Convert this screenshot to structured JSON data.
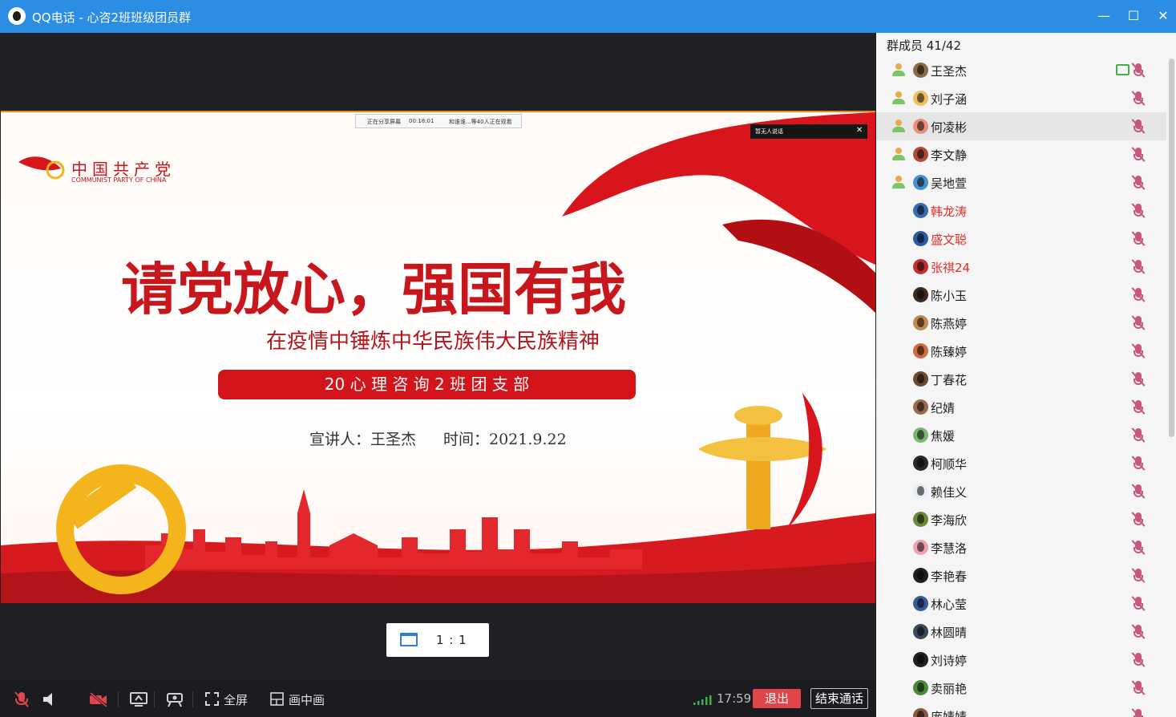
{
  "window": {
    "title": "QQ电话 - 心咨2班班级团员群",
    "minimize_label": "—",
    "maximize_label": "☐",
    "close_label": "✕"
  },
  "slide": {
    "party_logo_cn": "中国共产党",
    "party_logo_en": "COMMUNIST PARTY OF CHINA",
    "headline": "请党放心，强国有我",
    "subtitle": "在疫情中锤炼中华民族伟大民族精神",
    "banner": "20 心 理 咨 询 2 班 团 支 部",
    "speaker": "宣讲人：王圣杰",
    "date": "时间：2021.9.22",
    "top_bar_status": "正在分享屏幕",
    "top_bar_time": "00:18:01",
    "top_bar_note": "和谁谁...等40人正在观看",
    "talk_label": "暂无人说话",
    "talk_close": "✕"
  },
  "stage": {
    "ratio_label": "1 : 1"
  },
  "toolbar": {
    "fullscreen_label": "全屏",
    "pip_label": "画中画",
    "time": "17:59",
    "exit_label": "退出",
    "end_call_label": "结束通话"
  },
  "panel": {
    "header": "群成员 41/42",
    "members": [
      {
        "name": "王圣杰",
        "owner": true,
        "red": false,
        "sharing": true,
        "avatar": "#8a6a4a"
      },
      {
        "name": "刘子涵",
        "owner": true,
        "red": false,
        "sharing": false,
        "avatar": "#f0c060"
      },
      {
        "name": "何凌彬",
        "owner": true,
        "red": false,
        "sharing": false,
        "avatar": "#e8907a"
      },
      {
        "name": "李文静",
        "owner": true,
        "red": false,
        "sharing": false,
        "avatar": "#b04a3a"
      },
      {
        "name": "吴地萱",
        "owner": true,
        "red": false,
        "sharing": false,
        "avatar": "#4a90d0"
      },
      {
        "name": "韩龙涛",
        "owner": false,
        "red": true,
        "sharing": false,
        "avatar": "#3a6ab0"
      },
      {
        "name": "盛文聪",
        "owner": false,
        "red": true,
        "sharing": false,
        "avatar": "#2c5aa0"
      },
      {
        "name": "张祺24",
        "owner": false,
        "red": true,
        "sharing": false,
        "avatar": "#c03030"
      },
      {
        "name": "陈小玉",
        "owner": false,
        "red": false,
        "sharing": false,
        "avatar": "#3a2a20"
      },
      {
        "name": "陈燕婷",
        "owner": false,
        "red": false,
        "sharing": false,
        "avatar": "#c08a50"
      },
      {
        "name": "陈臻婷",
        "owner": false,
        "red": false,
        "sharing": false,
        "avatar": "#d06a40"
      },
      {
        "name": "丁春花",
        "owner": false,
        "red": false,
        "sharing": false,
        "avatar": "#6a4a30"
      },
      {
        "name": "纪婧",
        "owner": false,
        "red": false,
        "sharing": false,
        "avatar": "#9a6a50"
      },
      {
        "name": "焦媛",
        "owner": false,
        "red": false,
        "sharing": false,
        "avatar": "#7ab870"
      },
      {
        "name": "柯顺华",
        "owner": false,
        "red": false,
        "sharing": false,
        "avatar": "#2a2a2a"
      },
      {
        "name": "赖佳义",
        "owner": false,
        "red": false,
        "sharing": false,
        "avatar": "#e8eef5"
      },
      {
        "name": "李海欣",
        "owner": false,
        "red": false,
        "sharing": false,
        "avatar": "#6a8a3a"
      },
      {
        "name": "李慧洛",
        "owner": false,
        "red": false,
        "sharing": false,
        "avatar": "#f0a0b0"
      },
      {
        "name": "李艳春",
        "owner": false,
        "red": false,
        "sharing": false,
        "avatar": "#202020"
      },
      {
        "name": "林心莹",
        "owner": false,
        "red": false,
        "sharing": false,
        "avatar": "#3a5a9a"
      },
      {
        "name": "林圆晴",
        "owner": false,
        "red": false,
        "sharing": false,
        "avatar": "#3a4a5a"
      },
      {
        "name": "刘诗婷",
        "owner": false,
        "red": false,
        "sharing": false,
        "avatar": "#202020"
      },
      {
        "name": "卖丽艳",
        "owner": false,
        "red": false,
        "sharing": false,
        "avatar": "#4a8a3a"
      },
      {
        "name": "庞婧婧",
        "owner": false,
        "red": false,
        "sharing": false,
        "avatar": "#8a5a40"
      }
    ]
  }
}
